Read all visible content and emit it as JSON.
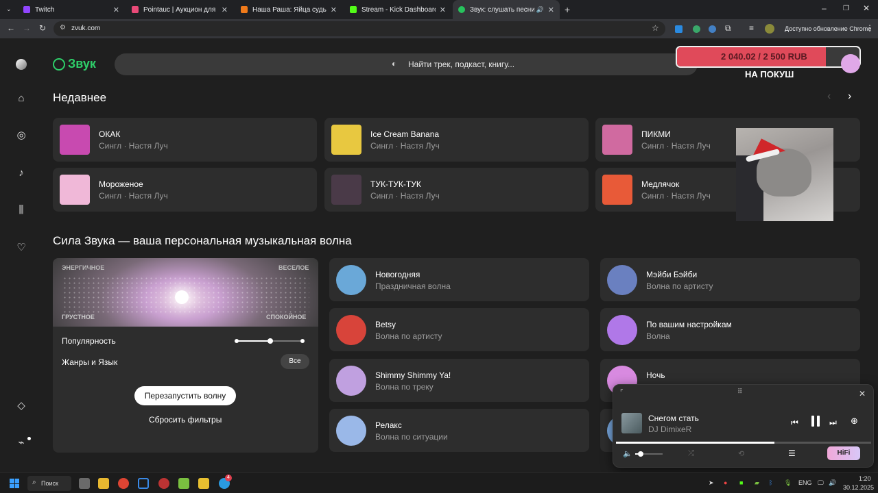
{
  "browser": {
    "tabs": [
      {
        "title": "Twitch",
        "color": "#9146ff"
      },
      {
        "title": "Pointauc | Аукцион для стрима",
        "color": "#e94a78"
      },
      {
        "title": "Наша Раша: Яйца судьбы смот...",
        "color": "#f07a1a"
      },
      {
        "title": "Stream - Kick Dashboard",
        "color": "#53fc18"
      },
      {
        "title": "Звук: слушать песни и муз...",
        "color": "#27c35d"
      }
    ],
    "url": "zvuk.com",
    "update_label": "Доступно обновление Chrome"
  },
  "app": {
    "logo": "Звук",
    "search_placeholder": "Найти трек, подкаст, книгу..."
  },
  "donation": {
    "amount": "2 040.02 / 2 500 RUB",
    "caption": "НА ПОКУШ",
    "progress": 0.816
  },
  "recent": {
    "title": "Недавнее",
    "items": [
      {
        "title": "ОКАК",
        "sub": "Сингл · Настя Луч",
        "color": "#c84ab0"
      },
      {
        "title": "Ice Cream Banana",
        "sub": "Сингл · Настя Луч",
        "color": "#e8c840"
      },
      {
        "title": "ПИКМИ",
        "sub": "Сингл · Настя Луч",
        "color": "#d06aa0"
      },
      {
        "title": "Мороженое",
        "sub": "Сингл · Настя Луч",
        "color": "#f0b8d8"
      },
      {
        "title": "ТУК-ТУК-ТУК",
        "sub": "Сингл · Настя Луч",
        "color": "#4a3a48"
      },
      {
        "title": "Медлячок",
        "sub": "Сингл · Настя Луч",
        "color": "#e85a38"
      }
    ]
  },
  "waves": {
    "title": "Сила Звука — ваша персональная музыкальная волна",
    "mood": {
      "energetic": "ЭНЕРГИЧНОЕ",
      "fun": "ВЕСЕЛОЕ",
      "sad": "ГРУСТНОЕ",
      "calm": "СПОКОЙНОЕ"
    },
    "popularity_label": "Популярность",
    "genres_label": "Жанры и Язык",
    "genres_value": "Все",
    "restart_label": "Перезапустить волну",
    "reset_label": "Сбросить фильтры",
    "items": [
      {
        "title": "Новогодняя",
        "sub": "Праздничная волна",
        "color": "#6aa8d8"
      },
      {
        "title": "Мэйби Бэйби",
        "sub": "Волна по артисту",
        "color": "#6a80c0"
      },
      {
        "title": "Betsy",
        "sub": "Волна по артисту",
        "color": "#d8443a"
      },
      {
        "title": "По вашим настройкам",
        "sub": "Волна",
        "color": "#b078e8"
      },
      {
        "title": "Shimmy Shimmy Ya!",
        "sub": "Волна по треку",
        "color": "#c0a0e0"
      },
      {
        "title": "Ночь",
        "sub": "",
        "color": "#d88ae0"
      },
      {
        "title": "Релакс",
        "sub": "Волна по ситуации",
        "color": "#9ab8e8"
      },
      {
        "title": "",
        "sub": "",
        "color": "#78a8e0"
      }
    ]
  },
  "player": {
    "track": "Снегом стать",
    "artist": "DJ DimixeR",
    "progress": 0.62,
    "volume": 0.2,
    "hifi": "HiFi"
  },
  "taskbar": {
    "search": "Поиск",
    "lang": "ENG",
    "time": "1:20",
    "date": "30.12.2025",
    "badge": "4"
  }
}
